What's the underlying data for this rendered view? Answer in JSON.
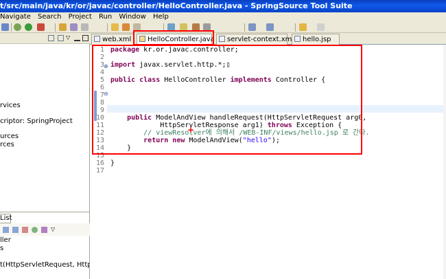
{
  "window": {
    "title": "t/src/main/java/kr/or/javac/controller/HelloController.java - SpringSource Tool Suite"
  },
  "menubar": {
    "items": [
      "Navigate",
      "Search",
      "Project",
      "Run",
      "Window",
      "Help"
    ]
  },
  "left_panel": {
    "lines": [
      "rvices",
      "criptor: SpringProject",
      "urces",
      "rces"
    ]
  },
  "bottom_panel": {
    "tab_label": "List",
    "lines": [
      "ller",
      "s",
      "t(HttpServletRequest, HttpServletR"
    ]
  },
  "editor_tabs": [
    {
      "label": "web.xml",
      "active": false
    },
    {
      "label": "HelloController.java",
      "active": true,
      "close": "✕"
    },
    {
      "label": "servlet-context.xml",
      "active": false
    },
    {
      "label": "hello.jsp",
      "active": false
    }
  ],
  "code": {
    "line_numbers": [
      "1",
      "2",
      "3",
      "4",
      "5",
      "6",
      "7",
      "8",
      "9",
      "10",
      "11",
      "12",
      "13",
      "14",
      "15",
      "16",
      "17"
    ],
    "lines": [
      {
        "n": "1",
        "parts": [
          {
            "t": "package",
            "k": "kw"
          },
          {
            "t": " kr.or.javac.controller;",
            "k": ""
          }
        ]
      },
      {
        "n": "3",
        "parts": [
          {
            "t": "import",
            "k": "kw"
          },
          {
            "t": " javax.servlet.http.*;",
            "k": ""
          },
          {
            "t": "▯",
            "k": ""
          }
        ]
      },
      {
        "n": "5",
        "parts": [
          {
            "t": "public class",
            "k": "kw"
          },
          {
            "t": " HelloController ",
            "k": ""
          },
          {
            "t": "implements",
            "k": "kw"
          },
          {
            "t": " Controller {",
            "k": ""
          }
        ]
      },
      {
        "n": "10",
        "parts": [
          {
            "t": "    public",
            "k": "kw"
          },
          {
            "t": " ModelAndView handleRequest(HttpServletRequest arg0,",
            "k": ""
          }
        ]
      },
      {
        "n": "11",
        "parts": [
          {
            "t": "            HttpServletResponse arg1) ",
            "k": ""
          },
          {
            "t": "throws",
            "k": "kw"
          },
          {
            "t": " Exception {",
            "k": ""
          }
        ]
      },
      {
        "n": "12",
        "parts": [
          {
            "t": "        // viewResolver에 의해서 /WEB-INF/views/hello.jsp 로 간다.",
            "k": "cmt"
          }
        ]
      },
      {
        "n": "13",
        "parts": [
          {
            "t": "        return new",
            "k": "kw"
          },
          {
            "t": " ModelAndView(",
            "k": ""
          },
          {
            "t": "\"hello\"",
            "k": "str"
          },
          {
            "t": ");",
            "k": ""
          }
        ]
      },
      {
        "n": "14",
        "parts": [
          {
            "t": "    }",
            "k": ""
          }
        ]
      },
      {
        "n": "16",
        "parts": [
          {
            "t": "}",
            "k": ""
          }
        ]
      }
    ]
  },
  "colors": {
    "highlight_box": "#ff0000",
    "keyword": "#7f0055",
    "string": "#2a00ff",
    "comment": "#3f7f5f"
  },
  "icons": [
    "save-icon",
    "debug-icon",
    "run-icon",
    "new-java-class-icon",
    "search-icon",
    "back-icon",
    "forward-icon"
  ]
}
